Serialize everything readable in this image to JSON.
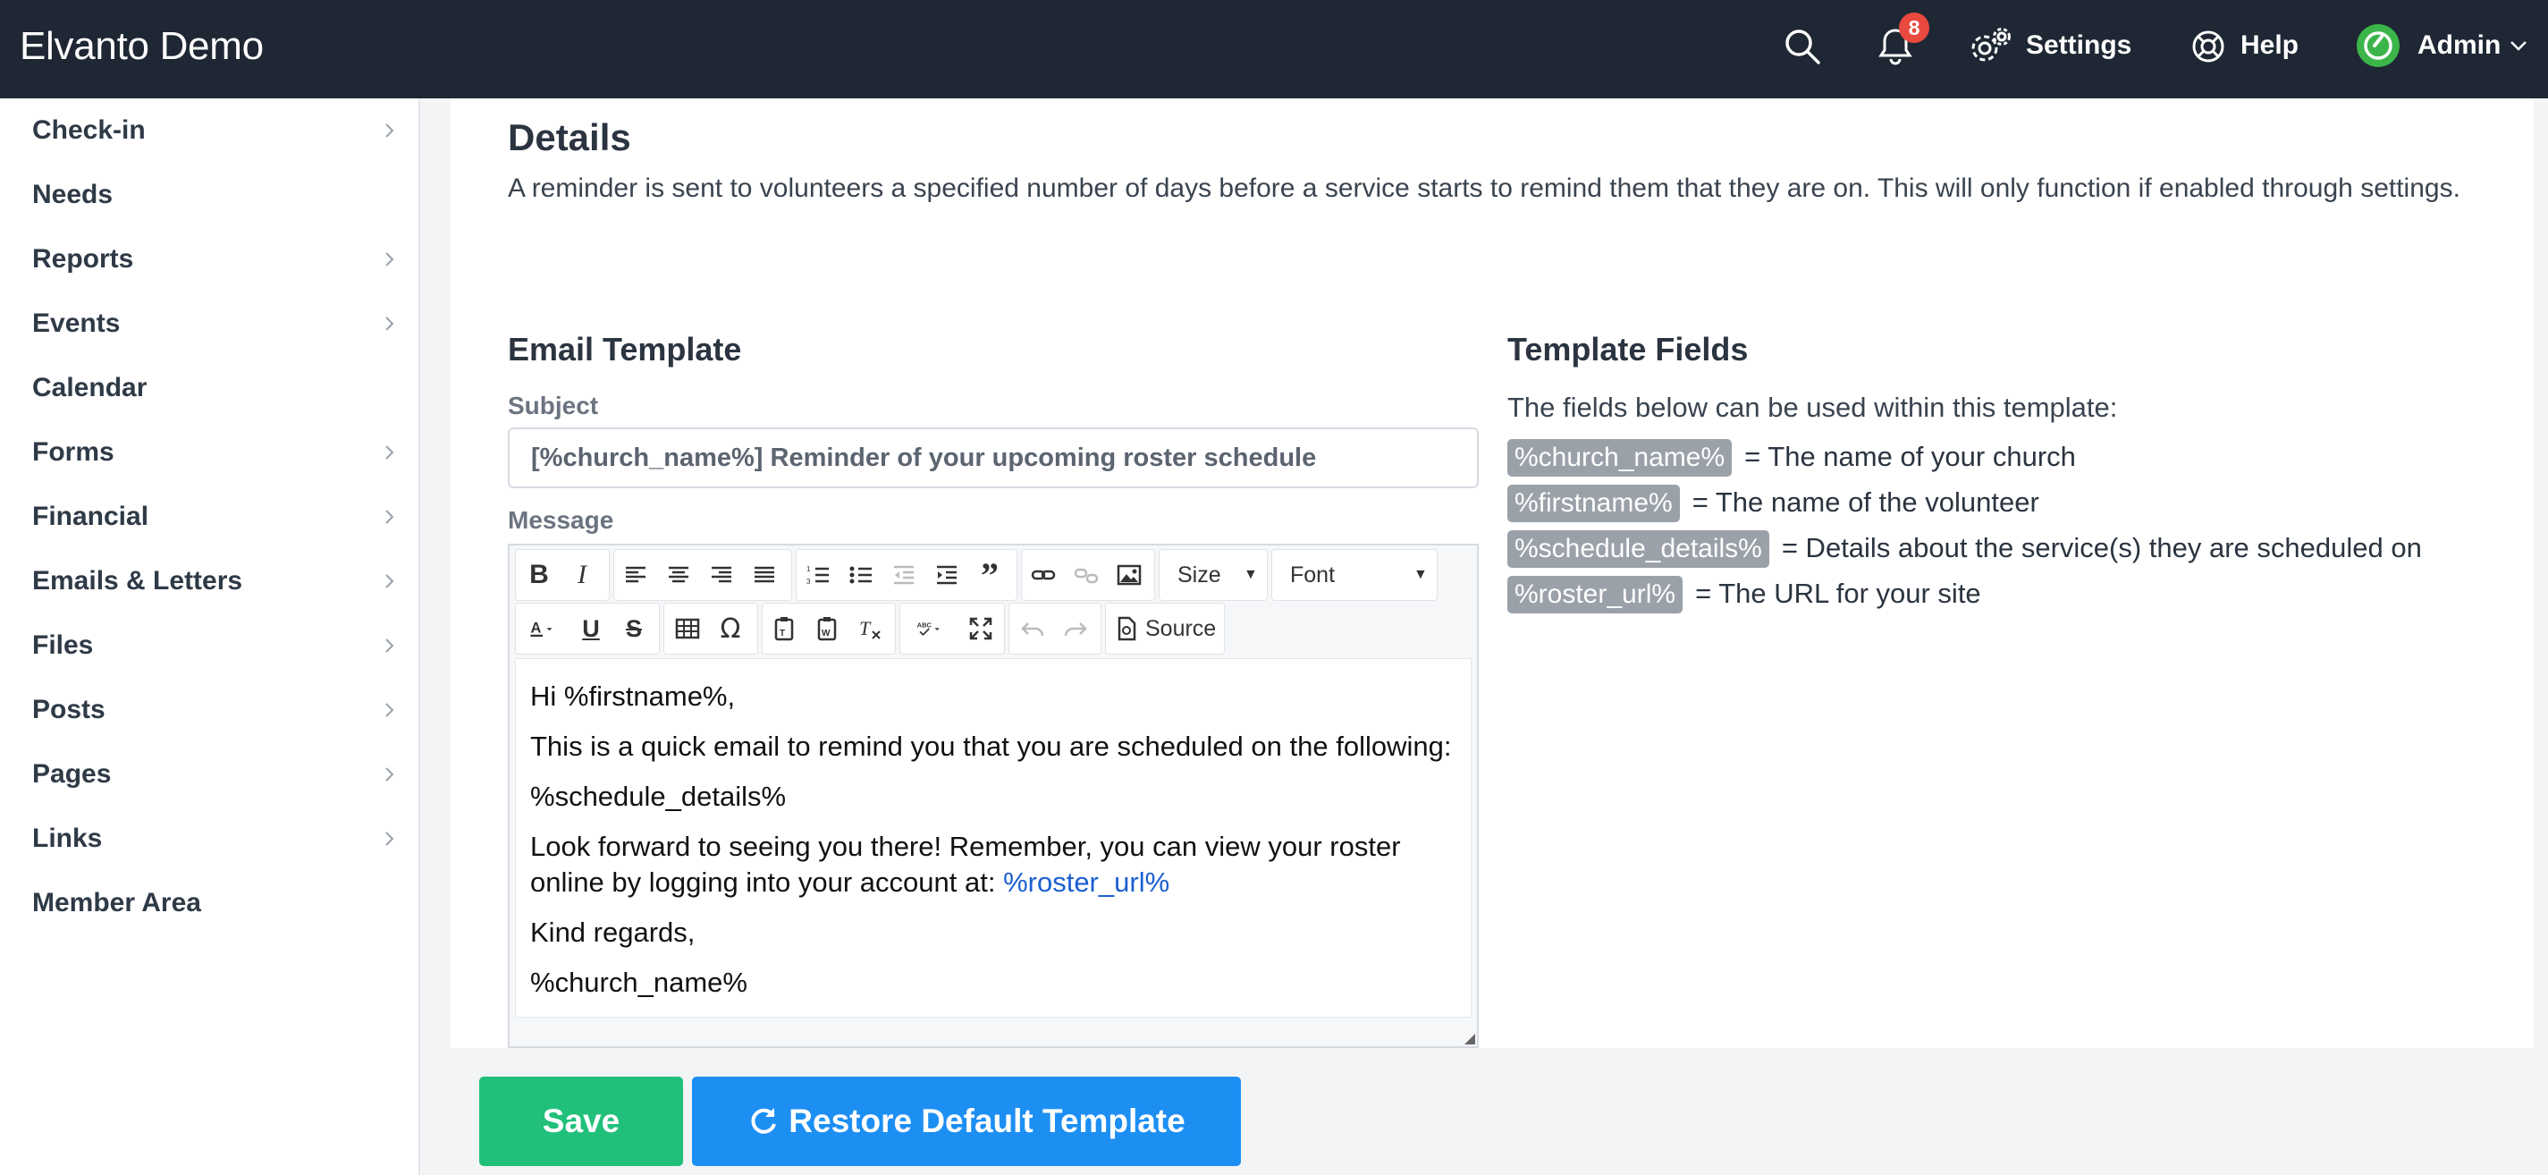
{
  "app": {
    "brand": "Elvanto Demo",
    "notifications_count": "8",
    "settings_label": "Settings",
    "help_label": "Help",
    "admin_label": "Admin"
  },
  "sidebar": {
    "items": [
      {
        "label": "Check-in",
        "has_submenu": true
      },
      {
        "label": "Needs",
        "has_submenu": false
      },
      {
        "label": "Reports",
        "has_submenu": true
      },
      {
        "label": "Events",
        "has_submenu": true
      },
      {
        "label": "Calendar",
        "has_submenu": false
      },
      {
        "label": "Forms",
        "has_submenu": true
      },
      {
        "label": "Financial",
        "has_submenu": true
      },
      {
        "label": "Emails & Letters",
        "has_submenu": true
      },
      {
        "label": "Files",
        "has_submenu": true
      },
      {
        "label": "Posts",
        "has_submenu": true
      },
      {
        "label": "Pages",
        "has_submenu": true
      },
      {
        "label": "Links",
        "has_submenu": true
      },
      {
        "label": "Member Area",
        "has_submenu": false
      }
    ]
  },
  "details": {
    "title": "Details",
    "description": "A reminder is sent to volunteers a specified number of days before a service starts to remind them that they are on. This will only function if enabled through settings."
  },
  "email_template": {
    "title": "Email Template",
    "subject_label": "Subject",
    "subject_value": "[%church_name%] Reminder of your upcoming roster schedule",
    "message_label": "Message",
    "toolbar": {
      "size_label": "Size",
      "font_label": "Font",
      "source_label": "Source"
    },
    "body": {
      "greeting": "Hi %firstname%,",
      "line1": "This is a quick email to remind you that you are scheduled on the following:",
      "line2": "%schedule_details%",
      "line3": "Look forward to seeing you there! Remember, you can view your roster online by logging into your account at: ",
      "roster_link": "%roster_url%",
      "line4": "Kind regards,",
      "line5": "%church_name%"
    }
  },
  "template_fields": {
    "title": "Template Fields",
    "intro": "The fields below can be used within this template:",
    "fields": [
      {
        "tag": "%church_name%",
        "desc": "= The name of your church"
      },
      {
        "tag": "%firstname%",
        "desc": "= The name of the volunteer"
      },
      {
        "tag": "%schedule_details%",
        "desc": "= Details about the service(s) they are scheduled on"
      },
      {
        "tag": "%roster_url%",
        "desc": "= The URL for your site"
      }
    ]
  },
  "actions": {
    "save_label": "Save",
    "restore_label": "Restore Default Template"
  },
  "colors": {
    "topbar": "#1e2733",
    "save": "#21c07a",
    "restore": "#1d8ff3",
    "badge": "#e9493e",
    "field_tag": "#9aa1a9"
  }
}
